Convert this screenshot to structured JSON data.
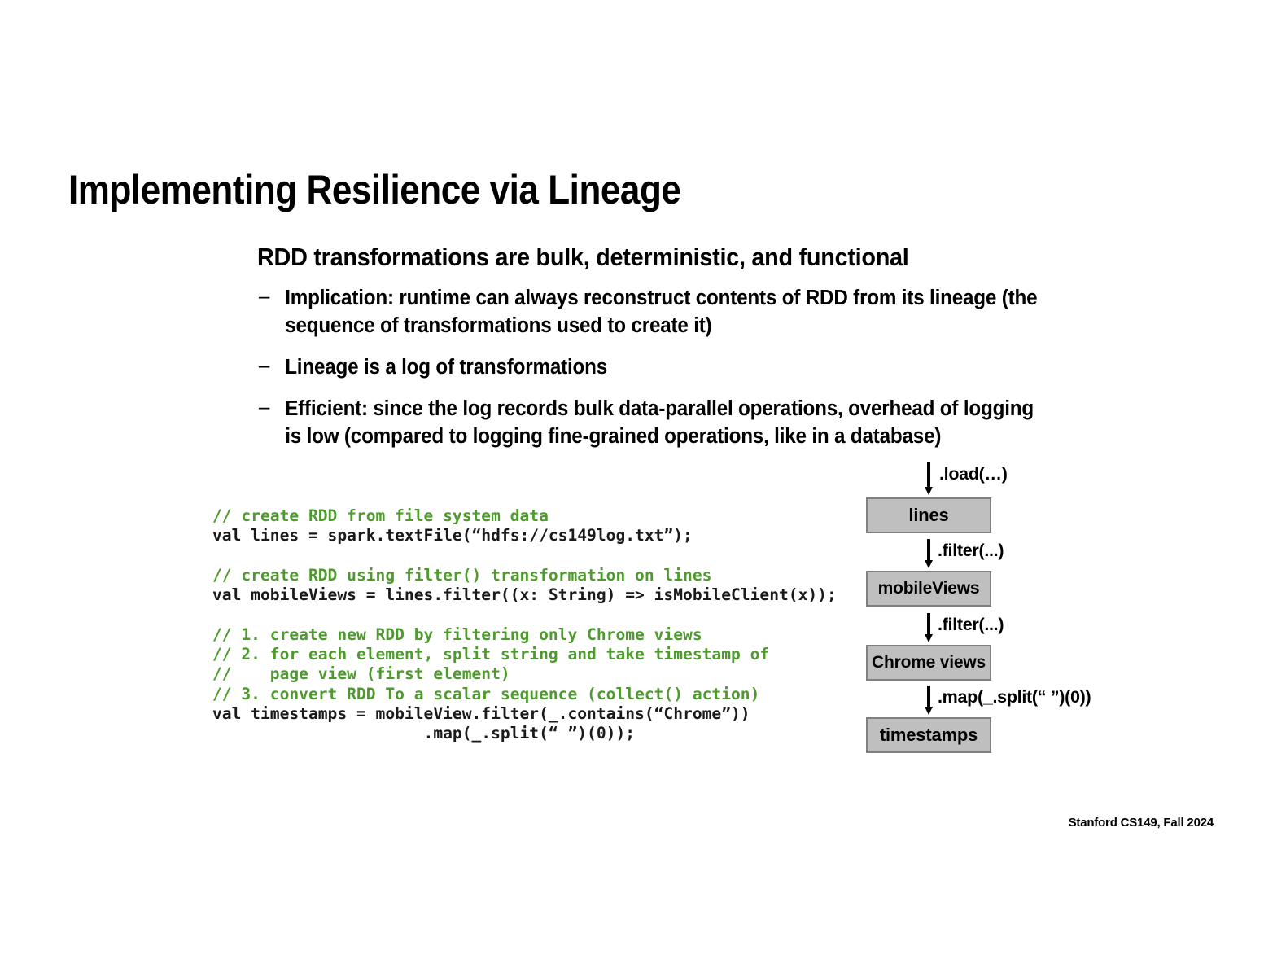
{
  "slide": {
    "title": "Implementing Resilience via Lineage",
    "subtitle": "RDD transformations are bulk, deterministic, and functional",
    "bullets": [
      "Implication: runtime can always reconstruct contents of RDD from its lineage (the sequence of transformations used to create it)",
      "Lineage is a log of transformations",
      "Efficient: since the log records bulk data-parallel operations, overhead of logging is low (compared to logging fine-grained operations, like in a database)"
    ],
    "bullet_marker": "–",
    "footer": "Stanford CS149, Fall 2024"
  },
  "code": {
    "comment_color": "#4f9a2f",
    "code_color": "#1a1a1a",
    "lines": [
      {
        "type": "comment",
        "text": "// create RDD from file system data"
      },
      {
        "type": "code",
        "text": "val lines = spark.textFile(“hdfs://cs149log.txt”);"
      },
      {
        "type": "blank",
        "text": ""
      },
      {
        "type": "comment",
        "text": "// create RDD using filter() transformation on lines"
      },
      {
        "type": "code",
        "text": "val mobileViews = lines.filter((x: String) => isMobileClient(x));"
      },
      {
        "type": "blank",
        "text": ""
      },
      {
        "type": "comment",
        "text": "// 1. create new RDD by filtering only Chrome views"
      },
      {
        "type": "comment",
        "text": "// 2. for each element, split string and take timestamp of"
      },
      {
        "type": "comment",
        "text": "//    page view (first element)"
      },
      {
        "type": "comment",
        "text": "// 3. convert RDD To a scalar sequence (collect() action)"
      },
      {
        "type": "code",
        "text": "val timestamps = mobileView.filter(_.contains(“Chrome”))"
      },
      {
        "type": "code",
        "text": "                      .map(_.split(“ ”)(0));"
      }
    ]
  },
  "lineage": {
    "box_fill": "#bfbfbf",
    "box_border": "#808080",
    "nodes": [
      {
        "label": "lines"
      },
      {
        "label": "mobileViews"
      },
      {
        "label": "Chrome views"
      },
      {
        "label": "timestamps"
      }
    ],
    "edges": [
      {
        "label": ".load(…)"
      },
      {
        "label": ".filter(...)"
      },
      {
        "label": ".filter(...)"
      },
      {
        "label": ".map(_.split(“ ”)(0))"
      }
    ]
  }
}
